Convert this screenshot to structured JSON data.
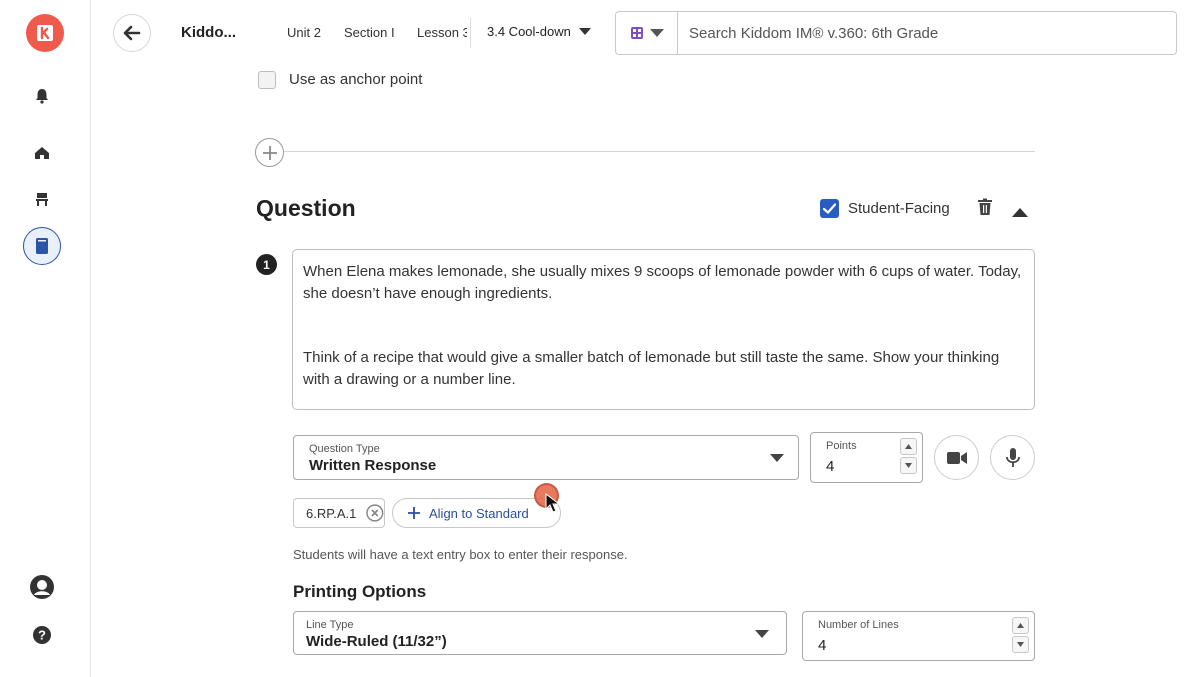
{
  "colors": {
    "brand": "#ef5a4c",
    "accent": "#2a5cbf",
    "link": "#2a4f9e",
    "cursor_highlight": "#e26242"
  },
  "sidebar": {
    "logo_icon": "kiddom-logo-icon",
    "items": [
      {
        "icon": "bell-icon",
        "active": false
      },
      {
        "icon": "home-icon",
        "active": false
      },
      {
        "icon": "classroom-chair-icon",
        "active": false
      },
      {
        "icon": "book-icon",
        "active": true
      }
    ],
    "bottom_items": [
      {
        "icon": "user-profile-icon"
      },
      {
        "icon": "help-icon"
      }
    ]
  },
  "header": {
    "course_title": "Kiddo...",
    "breadcrumbs": [
      {
        "label": "Unit 2"
      },
      {
        "label": "Section I"
      },
      {
        "label": "Lesson 3"
      }
    ],
    "lesson_select": "3.4 Cool-down",
    "search": {
      "placeholder": "Search Kiddom IM® v.360: 6th Grade",
      "value": ""
    }
  },
  "anchor": {
    "label": "Use as anchor point",
    "checked": false
  },
  "question": {
    "heading": "Question",
    "student_facing_label": "Student-Facing",
    "student_facing_checked": true,
    "number": "1",
    "paragraphs": [
      "When Elena makes lemonade, she usually mixes 9 scoops of lemonade powder with 6 cups of water. Today, she doesn’t have enough ingredients.",
      "Think of a recipe that would give a smaller batch of lemonade but still taste the same. Show your thinking with a drawing or a number line."
    ],
    "type_label": "Question Type",
    "type_value": "Written Response",
    "points_label": "Points",
    "points_value": "4",
    "standard_tag": "6.RP.A.1",
    "align_label": "Align to Standard",
    "helper_text": "Students will have a text entry box to enter their response."
  },
  "printing": {
    "heading": "Printing Options",
    "line_type_label": "Line Type",
    "line_type_value": "Wide-Ruled (11/32”)",
    "lines_label": "Number of Lines",
    "lines_value": "4"
  }
}
